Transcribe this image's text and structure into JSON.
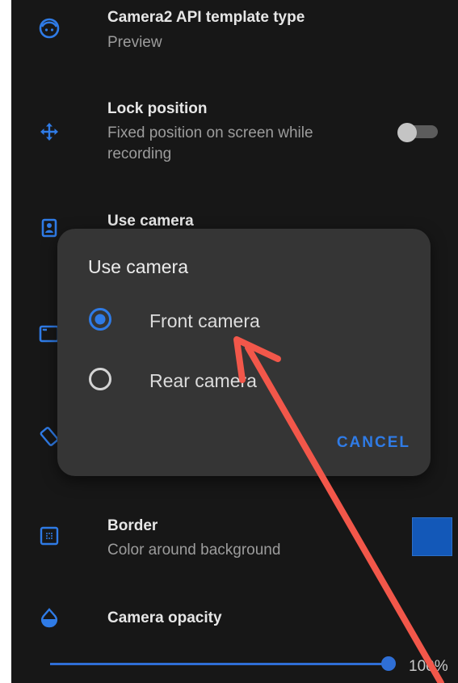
{
  "settings": {
    "camera2_template": {
      "title": "Camera2 API template type",
      "subtitle": "Preview",
      "icon": "face-icon"
    },
    "lock_position": {
      "title": "Lock position",
      "subtitle": "Fixed position on screen while recording",
      "icon": "move-icon",
      "toggle_on": false
    },
    "use_camera": {
      "title": "Use camera",
      "icon": "camera-portrait-icon"
    },
    "border": {
      "title": "Border",
      "subtitle": "Color around background",
      "icon": "grid-icon",
      "color": "#1358b8"
    },
    "camera_opacity": {
      "title": "Camera opacity",
      "icon": "drop-icon",
      "value": "100%",
      "level": 1.0
    }
  },
  "dialog": {
    "title": "Use camera",
    "options": [
      {
        "label": "Front camera",
        "selected": true
      },
      {
        "label": "Rear camera",
        "selected": false
      }
    ],
    "cancel_label": "CANCEL"
  },
  "colors": {
    "background": "#171717",
    "dialog": "#353535",
    "accent": "#2f7be6",
    "annotation": "#f2574a"
  }
}
